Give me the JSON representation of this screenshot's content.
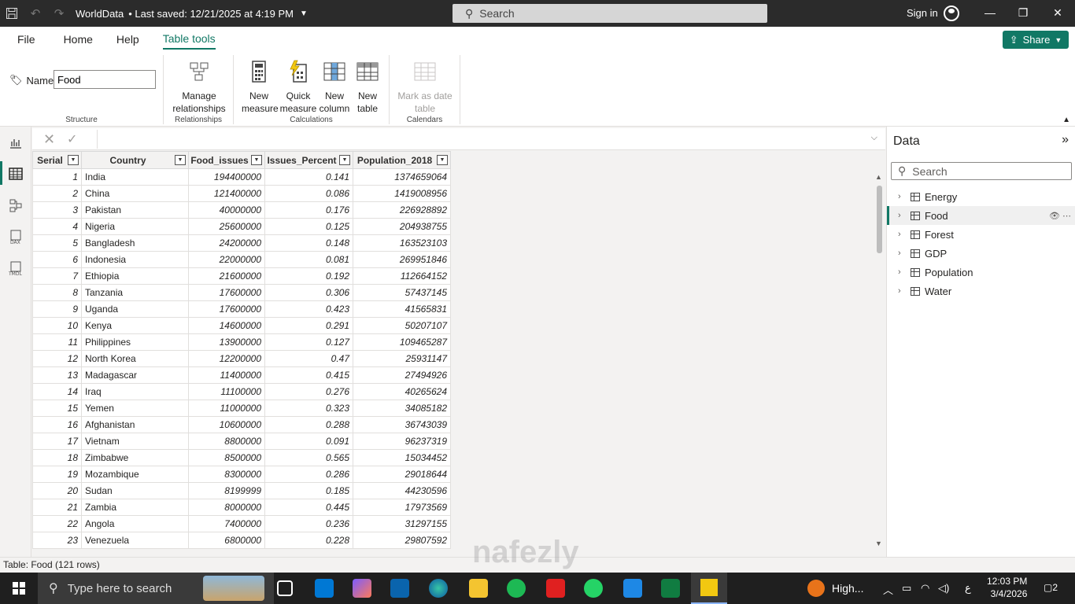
{
  "titlebar": {
    "title": "WorldData",
    "saved": "• Last saved: 12/21/2025 at 4:19 PM",
    "search_placeholder": "Search",
    "signin": "Sign in"
  },
  "ribbon_tabs": [
    "File",
    "Home",
    "Help",
    "Table tools"
  ],
  "share_label": "Share",
  "ribbon": {
    "name_label": "Name",
    "name_value": "Food",
    "structure_label": "Structure",
    "manage_rel_1": "Manage",
    "manage_rel_2": "relationships",
    "relationships_label": "Relationships",
    "new_measure_1": "New",
    "new_measure_2": "measure",
    "quick_measure_1": "Quick",
    "quick_measure_2": "measure",
    "new_column_1": "New",
    "new_column_2": "column",
    "new_table_1": "New",
    "new_table_2": "table",
    "calculations_label": "Calculations",
    "mark_date_1": "Mark as date",
    "mark_date_2": "table",
    "calendars_label": "Calendars"
  },
  "table": {
    "columns": [
      "Serial",
      "Country",
      "Food_issues",
      "Issues_Percent",
      "Population_2018"
    ],
    "rows": [
      [
        "1",
        "India",
        "194400000",
        "0.141",
        "1374659064"
      ],
      [
        "2",
        "China",
        "121400000",
        "0.086",
        "1419008956"
      ],
      [
        "3",
        "Pakistan",
        "40000000",
        "0.176",
        "226928892"
      ],
      [
        "4",
        "Nigeria",
        "25600000",
        "0.125",
        "204938755"
      ],
      [
        "5",
        "Bangladesh",
        "24200000",
        "0.148",
        "163523103"
      ],
      [
        "6",
        "Indonesia",
        "22000000",
        "0.081",
        "269951846"
      ],
      [
        "7",
        "Ethiopia",
        "21600000",
        "0.192",
        "112664152"
      ],
      [
        "8",
        "Tanzania",
        "17600000",
        "0.306",
        "57437145"
      ],
      [
        "9",
        "Uganda",
        "17600000",
        "0.423",
        "41565831"
      ],
      [
        "10",
        "Kenya",
        "14600000",
        "0.291",
        "50207107"
      ],
      [
        "11",
        "Philippines",
        "13900000",
        "0.127",
        "109465287"
      ],
      [
        "12",
        "North Korea",
        "12200000",
        "0.47",
        "25931147"
      ],
      [
        "13",
        "Madagascar",
        "11400000",
        "0.415",
        "27494926"
      ],
      [
        "14",
        "Iraq",
        "11100000",
        "0.276",
        "40265624"
      ],
      [
        "15",
        "Yemen",
        "11000000",
        "0.323",
        "34085182"
      ],
      [
        "16",
        "Afghanistan",
        "10600000",
        "0.288",
        "36743039"
      ],
      [
        "17",
        "Vietnam",
        "8800000",
        "0.091",
        "96237319"
      ],
      [
        "18",
        "Zimbabwe",
        "8500000",
        "0.565",
        "15034452"
      ],
      [
        "19",
        "Mozambique",
        "8300000",
        "0.286",
        "29018644"
      ],
      [
        "20",
        "Sudan",
        "8199999",
        "0.185",
        "44230596"
      ],
      [
        "21",
        "Zambia",
        "8000000",
        "0.445",
        "17973569"
      ],
      [
        "22",
        "Angola",
        "7400000",
        "0.236",
        "31297155"
      ],
      [
        "23",
        "Venezuela",
        "6800000",
        "0.228",
        "29807592"
      ]
    ]
  },
  "data_pane": {
    "title": "Data",
    "search_placeholder": "Search",
    "tables": [
      "Energy",
      "Food",
      "Forest",
      "GDP",
      "Population",
      "Water"
    ],
    "selected": "Food"
  },
  "status": "Table: Food (121 rows)",
  "taskbar": {
    "search_placeholder": "Type here to search",
    "weather": "High...",
    "lang": "ع",
    "time": "12:03 PM",
    "date": "3/4/2026",
    "notifications": "2"
  },
  "colors": {
    "accent": "#117865",
    "titlebar": "#2b2b2b",
    "taskbar": "#1f1f1f"
  }
}
